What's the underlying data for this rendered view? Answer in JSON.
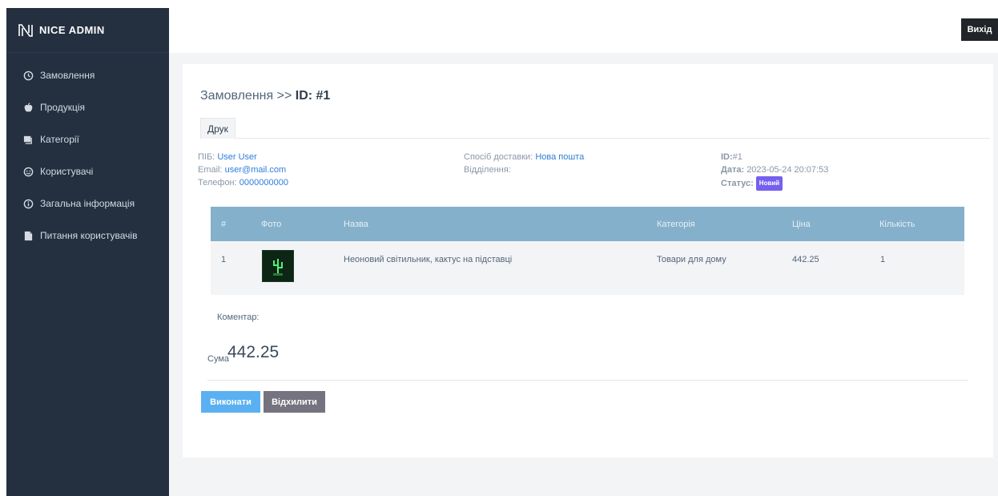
{
  "brand": {
    "name": "NICE ADMIN"
  },
  "sidebar": {
    "items": [
      {
        "label": "Замовлення",
        "icon": "clock-icon"
      },
      {
        "label": "Продукція",
        "icon": "apple-icon"
      },
      {
        "label": "Категорії",
        "icon": "folder-stack-icon"
      },
      {
        "label": "Користувачі",
        "icon": "smile-icon"
      },
      {
        "label": "Загальна інформація",
        "icon": "info-icon"
      },
      {
        "label": "Питання користувачів",
        "icon": "document-icon"
      }
    ]
  },
  "topbar": {
    "logout_label": "Вихід"
  },
  "page": {
    "title_prefix": "Замовлення >>",
    "title_id": "ID: #1",
    "tab_print": "Друк"
  },
  "customer": {
    "name_label": "ПІБ:",
    "name_value": "User User",
    "email_label": "Email:",
    "email_value": "user@mail.com",
    "phone_label": "Телефон:",
    "phone_value": "0000000000"
  },
  "delivery": {
    "method_label": "Спосіб доставки:",
    "method_value": "Нова пошта",
    "branch_label": "Відділення:",
    "branch_value": ""
  },
  "order_meta": {
    "id_label": "ID:",
    "id_value": "#1",
    "date_label": "Дата:",
    "date_value": "2023-05-24 20:07:53",
    "status_label": "Статус:",
    "status_value": "Новий",
    "status_color": "#7460ee"
  },
  "table": {
    "headers": [
      "#",
      "Фото",
      "Назва",
      "Категорія",
      "Ціна",
      "Кількість"
    ],
    "rows": [
      {
        "num": "1",
        "photo_icon": "cactus-neon-icon",
        "name": "Неоновий світильник, кактус на підставці",
        "category": "Товари для дому",
        "price": "442.25",
        "qty": "1"
      }
    ]
  },
  "comment_label": "Коментар:",
  "sum": {
    "label": "Сума",
    "value": "442.25"
  },
  "actions": {
    "confirm_label": "Виконати",
    "reject_label": "Відхилити"
  },
  "colors": {
    "sidebar": "#243040",
    "table_head": "#84b0cb",
    "confirm": "#5ab0f1",
    "reject": "#75737f",
    "link": "#2f7ed8"
  }
}
